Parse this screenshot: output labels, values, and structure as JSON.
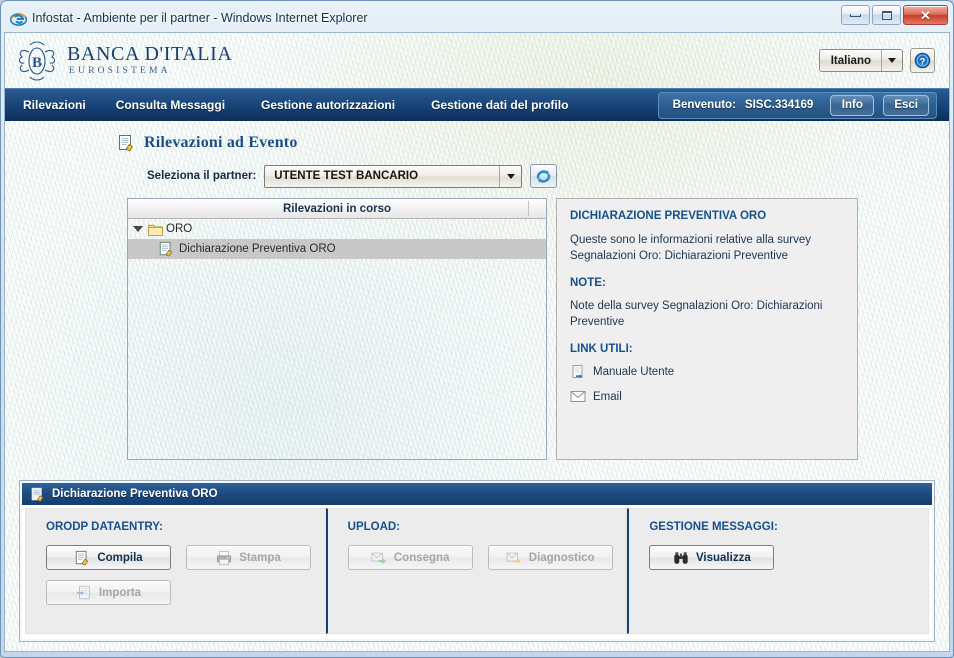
{
  "window": {
    "title": "Infostat - Ambiente per il partner - Windows Internet Explorer",
    "icon": "ie-icon",
    "minimize_label": "",
    "maximize_label": "",
    "close_label": "✕"
  },
  "brand": {
    "name": "BANCA D'ITALIA",
    "subtitle": "EUROSISTEMA",
    "logo_icon": "banca-ditalia-emblem-icon",
    "language": "Italiano",
    "help_icon": "help-question-icon"
  },
  "nav": {
    "items": [
      {
        "label": "Rilevazioni"
      },
      {
        "label": "Consulta Messaggi"
      },
      {
        "label": "Gestione autorizzazioni"
      },
      {
        "label": "Gestione dati del profilo"
      }
    ],
    "welcome_label": "Benvenuto:",
    "user": "SISC.334169",
    "info_button": "Info",
    "logout_button": "Esci"
  },
  "page": {
    "title": "Rilevazioni ad Evento",
    "title_icon": "document-edit-icon",
    "partner_label": "Seleziona il partner:",
    "partner_value": "UTENTE TEST BANCARIO",
    "refresh_icon": "refresh-icon"
  },
  "tree": {
    "header": "Rilevazioni in corso",
    "nodes": [
      {
        "label": "ORO",
        "icon": "folder-icon",
        "level": 0,
        "expanded": true,
        "selected": false
      },
      {
        "label": "Dichiarazione Preventiva ORO",
        "icon": "document-edit-icon",
        "level": 1,
        "expanded": false,
        "selected": true
      }
    ]
  },
  "info": {
    "heading": "DICHIARAZIONE PREVENTIVA ORO",
    "description": "Queste sono le informazioni relative alla survey Segnalazioni Oro: Dichiarazioni Preventive",
    "notes_heading": "NOTE:",
    "notes_body": "Note della survey Segnalazioni Oro: Dichiarazioni Preventive",
    "links_heading": "LINK UTILI:",
    "links": [
      {
        "label": "Manuale Utente",
        "icon": "document-export-icon"
      },
      {
        "label": "Email",
        "icon": "envelope-icon"
      }
    ]
  },
  "bottom": {
    "title": "Dichiarazione Preventiva ORO",
    "title_icon": "document-edit-icon",
    "sections": [
      {
        "title": "ORODP DATAENTRY:",
        "buttons": [
          {
            "label": "Compila",
            "icon": "document-edit-icon",
            "enabled": true
          },
          {
            "label": "Stampa",
            "icon": "printer-icon",
            "enabled": false
          },
          {
            "label": "Importa",
            "icon": "import-icon",
            "enabled": false
          }
        ]
      },
      {
        "title": "UPLOAD:",
        "buttons": [
          {
            "label": "Consegna",
            "icon": "envelope-green-arrow-icon",
            "enabled": false
          },
          {
            "label": "Diagnostico",
            "icon": "envelope-orange-arrow-icon",
            "enabled": false
          }
        ]
      },
      {
        "title": "GESTIONE MESSAGGI:",
        "buttons": [
          {
            "label": "Visualizza",
            "icon": "binoculars-icon",
            "enabled": true
          }
        ]
      }
    ]
  },
  "colors": {
    "brand_blue": "#1b4e88",
    "nav_blue": "#123a6b",
    "heading_blue": "#15508f",
    "selection_grey": "#c8c8c8"
  }
}
